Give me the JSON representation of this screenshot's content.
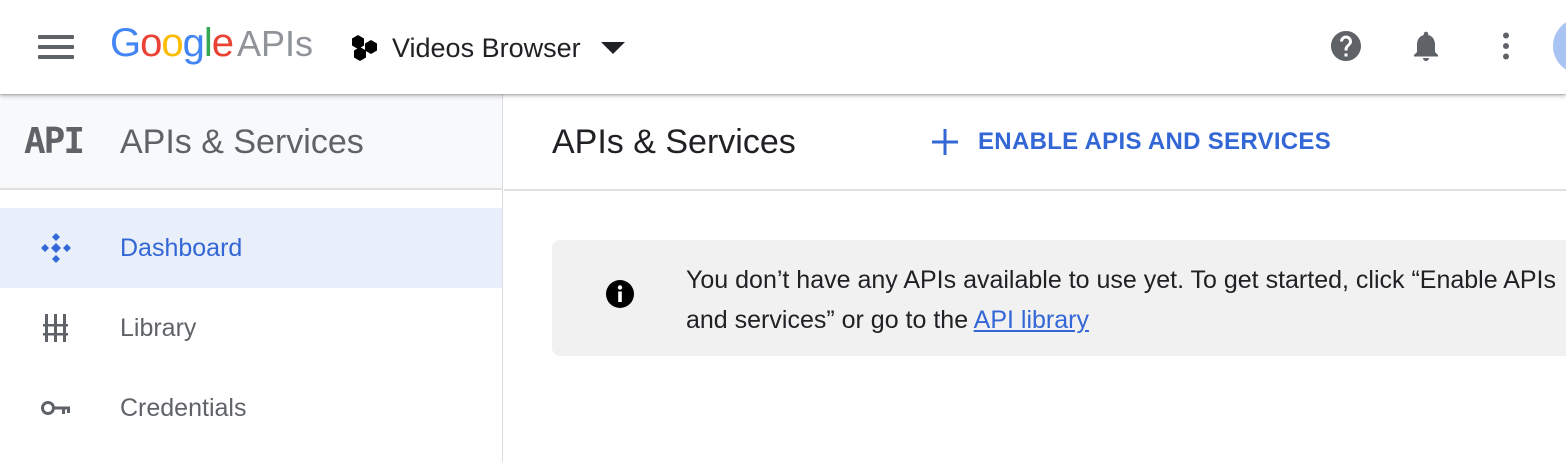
{
  "header": {
    "logo_google_letters": [
      "G",
      "o",
      "o",
      "g",
      "l",
      "e"
    ],
    "logo_product": "APIs",
    "project_name": "Videos Browser",
    "icons": [
      "menu-icon",
      "project-icon",
      "chevron-down-icon",
      "help-icon",
      "bell-icon",
      "more-vert-icon",
      "avatar"
    ]
  },
  "sidebar": {
    "badge": "API",
    "title": "APIs & Services",
    "items": [
      {
        "label": "Dashboard",
        "icon": "dashboard-icon",
        "active": true
      },
      {
        "label": "Library",
        "icon": "library-icon",
        "active": false
      },
      {
        "label": "Credentials",
        "icon": "key-icon",
        "active": false
      }
    ]
  },
  "main": {
    "title": "APIs & Services",
    "enable_button": "ENABLE APIS AND SERVICES",
    "info": {
      "text": "You don’t have any APIs available to use yet. To get started, click “Enable APIs and services” or go to the ",
      "link": "API library"
    }
  },
  "colors": {
    "accent": "#3367d6",
    "google_blue": "#4285f4",
    "google_red": "#ea4335",
    "google_yellow": "#fbbc05",
    "google_green": "#34a853",
    "active_bg": "#e8eefa",
    "banner_bg": "#f1f1f1"
  }
}
